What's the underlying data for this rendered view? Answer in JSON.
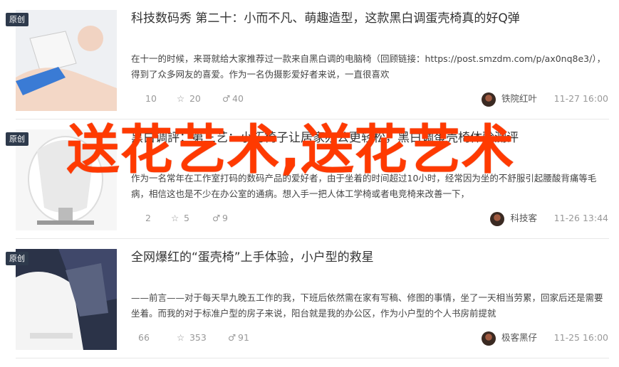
{
  "badge_label": "原创",
  "articles": [
    {
      "title": "科技数码秀 第二十：小而不凡、萌趣造型，这款黑白调蛋壳椅真的好Q弹",
      "excerpt": "在十一的时候，来哥就给大家推荐过一款来自黑白调的电脑椅（回顾链接：https://post.smzdm.com/p/ax0nq8e3/），得到了众多网友的喜爱。作为一名伪摄影爱好者来说，一直很喜欢",
      "comments": "10",
      "favorites": "20",
      "likes": "40",
      "author": "铁院红叶",
      "date": "11-27 16:00"
    },
    {
      "title": "黑白调評：第三艺：小巧椅子让居家办公更轻松，黑白调蛋壳椅体验测评",
      "excerpt": "作为一名常年在工作室打码的数码产品的爱好者，由于坐着的时间超过10小时，经常因为坐的不舒服引起腰酸背痛等毛病，相信这也是不少在办公室的通病。想入手一把人体工学椅或者电竞椅来改善一下，",
      "comments": "2",
      "favorites": "5",
      "likes": "9",
      "author": "科技客",
      "date": "11-26 13:44"
    },
    {
      "title": "全网爆红的“蛋壳椅”上手体验，小户型的救星",
      "excerpt": "——前言——对于每天早九晚五工作的我，下班后依然需在家有写稿、修图的事情，坐了一天相当劳累，回家后还是需要坐着。而我的对于标准户型的房子来说，阳台就是我的办公区，作为小户型的个人书房前提就",
      "comments": "66",
      "favorites": "353",
      "likes": "91",
      "author": "极客黑仔",
      "date": "11-25 16:00"
    }
  ],
  "overlay_text": "送花艺术,送花艺术",
  "colors": {
    "overlay": "#ff3a00",
    "badge": "#2e3a4c"
  },
  "icons": {
    "comment": "comment-icon",
    "favorite": "star-icon",
    "like": "thumb-up-icon"
  }
}
